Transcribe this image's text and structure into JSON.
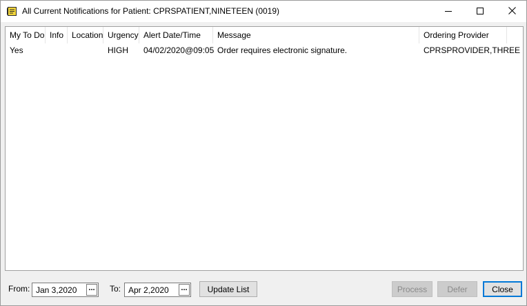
{
  "window": {
    "title": "All Current Notifications for Patient: CPRSPATIENT,NINETEEN (0019)"
  },
  "list": {
    "columns": [
      {
        "label": "My To Do"
      },
      {
        "label": "Info"
      },
      {
        "label": "Location"
      },
      {
        "label": "Urgency"
      },
      {
        "label": "Alert Date/Time"
      },
      {
        "label": "Message"
      },
      {
        "label": "Ordering Provider"
      }
    ],
    "rows": [
      {
        "my_to_do": "Yes",
        "info": "",
        "location": "",
        "urgency": "HIGH",
        "alert_datetime": "04/02/2020@09:05",
        "message": "Order requires electronic signature.",
        "ordering_provider": "CPRSPROVIDER,THREE"
      }
    ]
  },
  "footer": {
    "from_label": "From:",
    "from_value": "Jan 3,2020",
    "to_label": "To:",
    "to_value": "Apr 2,2020",
    "date_picker_glyph": "...",
    "update_label": "Update List",
    "process_label": "Process",
    "defer_label": "Defer",
    "close_label": "Close"
  }
}
